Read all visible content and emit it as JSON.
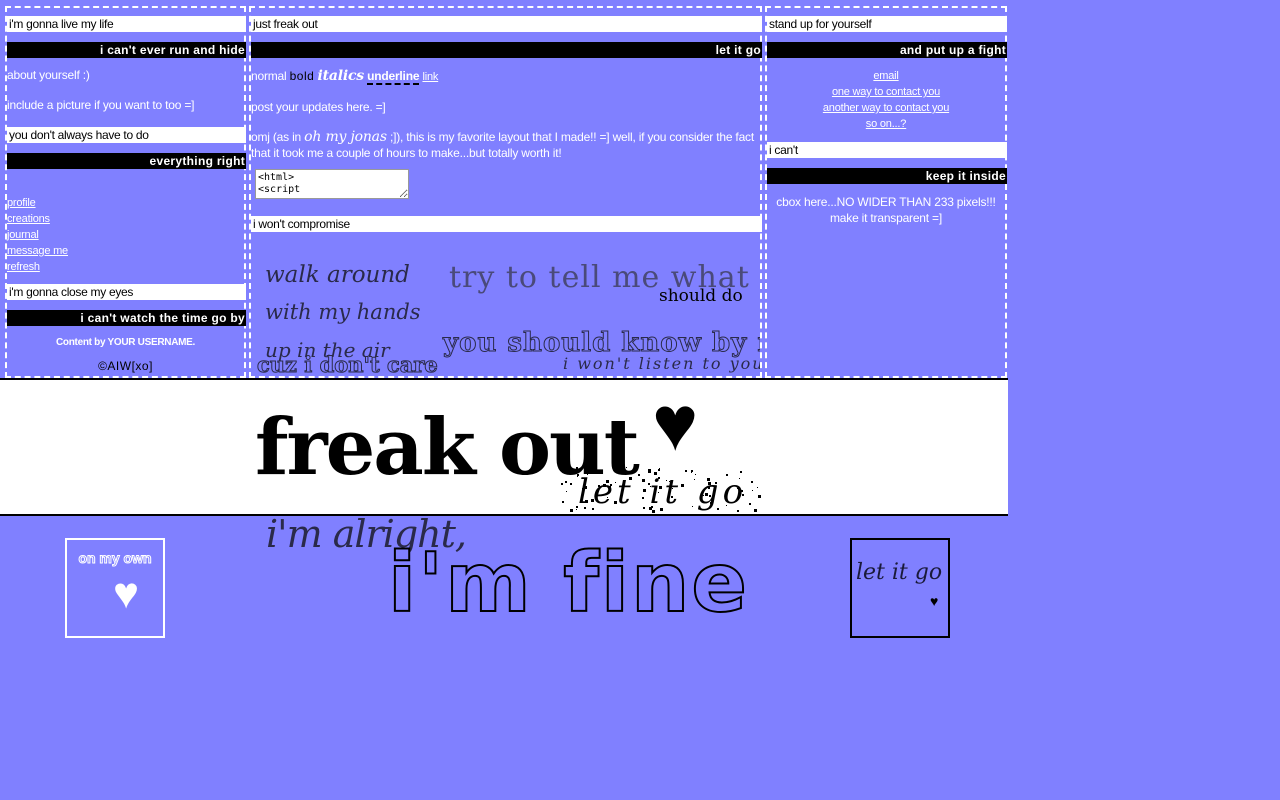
{
  "left": {
    "h1": "i'm gonna live my life",
    "h1b": "i can't ever run and hide",
    "about": "about yourself :)",
    "picture": "include a picture if you want to too =]",
    "h2": "you don't always have to do",
    "h2b": "everything right",
    "links": [
      "profile",
      "creations",
      "journal",
      "message me",
      "refresh"
    ],
    "h3": "i'm gonna close my eyes",
    "h3b": "i can't watch the time go by",
    "content": "Content by YOUR USERNAME.",
    "copyright": "©AIW[xo]"
  },
  "mid": {
    "h1": "just freak out",
    "h1b": "let it go",
    "fmt_normal": "normal",
    "fmt_bold": "bold",
    "fmt_italics": "italics",
    "fmt_underline": "underline",
    "fmt_link": "link",
    "updates": "post your updates here. =]",
    "favorite_pre": "omj (as in ",
    "favorite_em": "oh my jonas",
    "favorite_post": " ;]), this is my favorite layout that I made!! =] well, if you consider the fact that it took me a couple of hours to make...but totally worth it!",
    "code": "<html>\n<script",
    "h2": "i won't compromise",
    "lyrics": {
      "walk": "walk around",
      "hands": "with my hands",
      "air": "up in the air",
      "dont_care": "cuz i don't care",
      "try": "try to tell me what i",
      "should_do": "should do",
      "should_know": "you should know by now",
      "wont_listen": "i won't listen to you"
    }
  },
  "right": {
    "h1": "stand up for yourself",
    "h1b": "and put up a fight",
    "contacts": [
      "email",
      "one way to contact you",
      "another way to contact you",
      "so on...?"
    ],
    "h2": "i can't",
    "h2b": "keep it inside",
    "cbox": "cbox here...NO WIDER THAN 233 pixels!!! make it transparent =]"
  },
  "banner": {
    "title": "freak out",
    "sub": "let it go"
  },
  "bottom": {
    "fine_small": "i'm alright,",
    "fine_big": "i'm fine",
    "box_left": "on my own",
    "box_right": "let it go"
  },
  "colors": {
    "background": "#8080ff",
    "white": "#ffffff",
    "black": "#000000"
  }
}
